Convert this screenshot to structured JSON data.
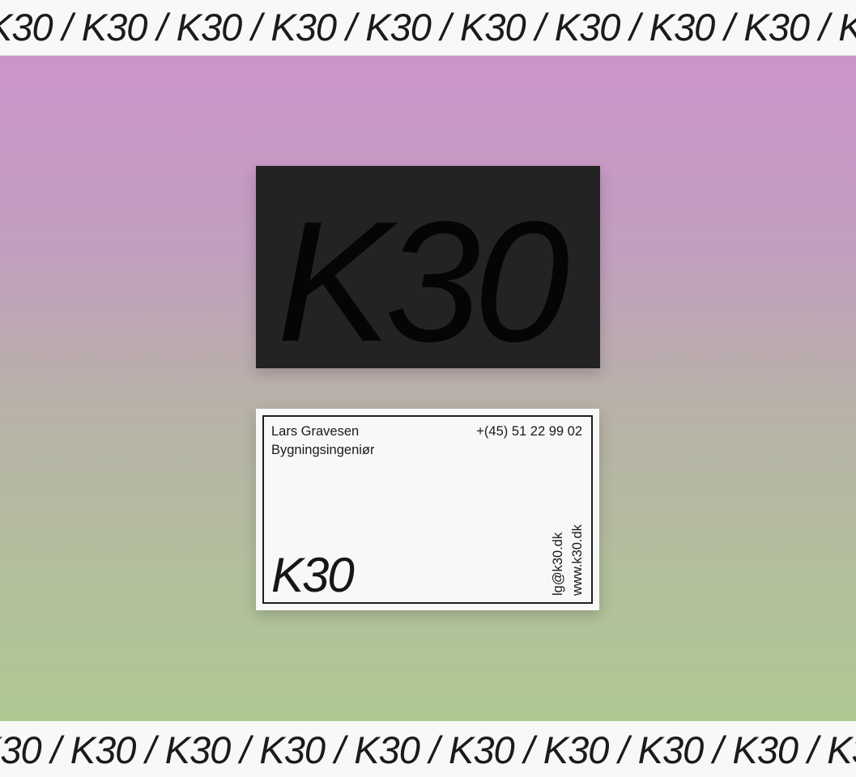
{
  "banner_top": {
    "text": "K30 / K30 / K30 / K30 / K30 / K30 / K30 / K30 / K30 / K30"
  },
  "banner_bottom": {
    "text": "K30 / K30 / K30 / K30 / K30 / K30 / K30 / K30 / K30 / K30"
  },
  "card_back": {
    "logo": "K30"
  },
  "card_front": {
    "name": "Lars Gravesen",
    "title": "Bygningsingeniør",
    "phone": "+(45) 51 22 99 02",
    "logo": "K30",
    "email": "lg@k30.dk",
    "website": "www.k30.dk"
  },
  "colors": {
    "gradient_top": "#cd94cb",
    "gradient_bottom": "#aec892",
    "card_back": "#232323",
    "card_front": "#f8f8f8"
  }
}
